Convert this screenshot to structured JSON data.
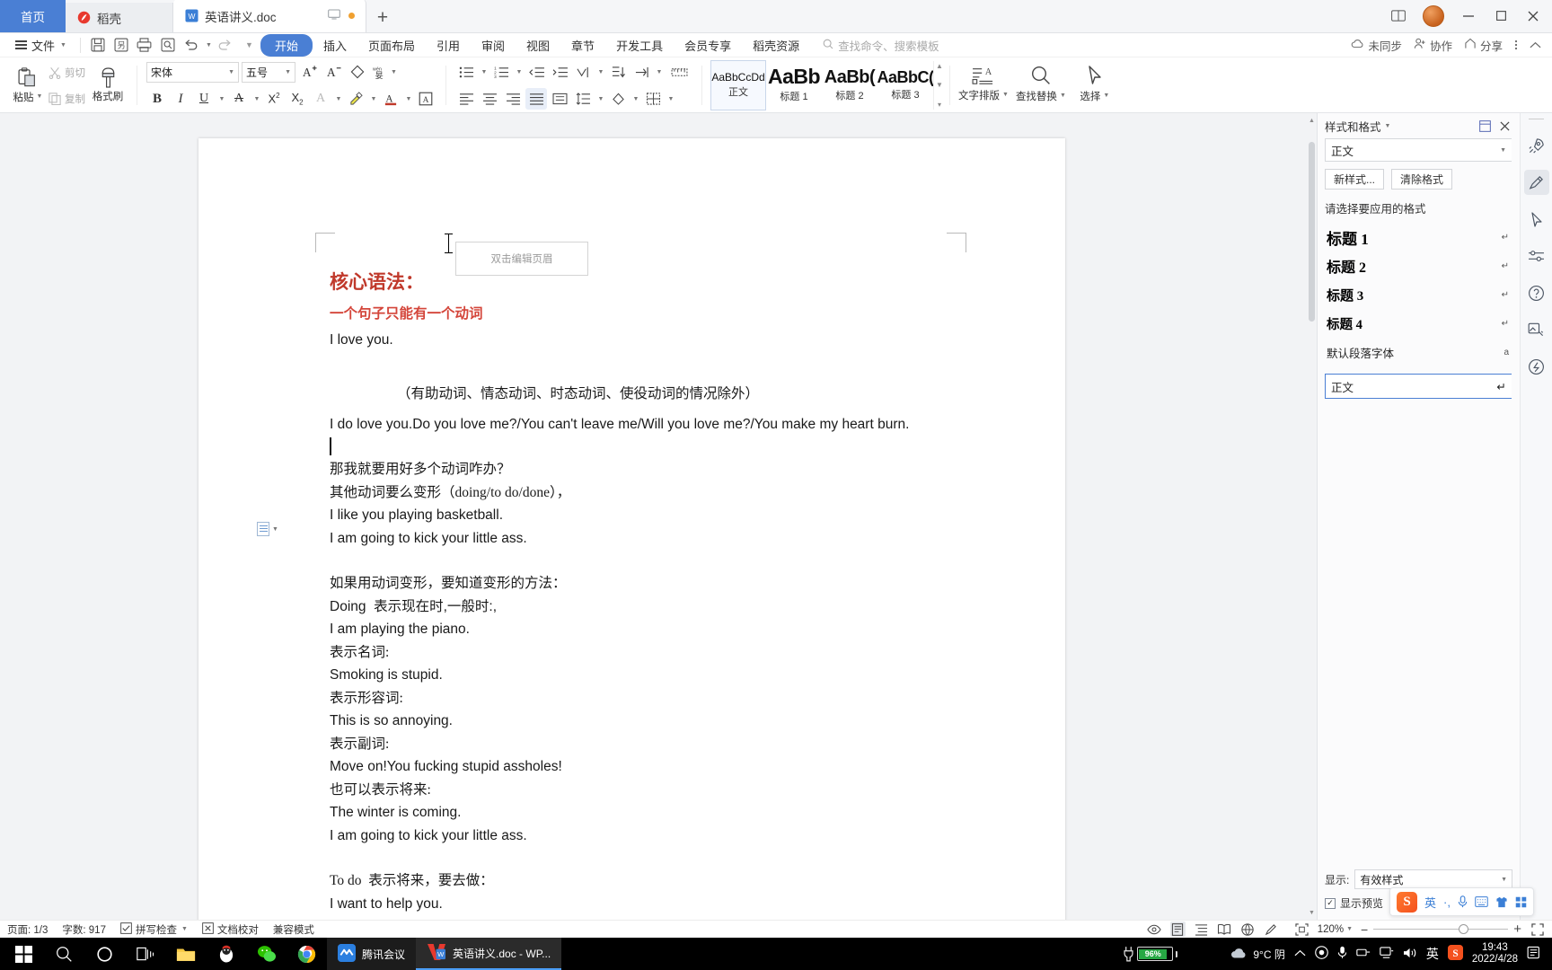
{
  "tabbar": {
    "home_label": "首页",
    "tabs": [
      {
        "label": "稻壳",
        "icon": "docer-icon"
      },
      {
        "label": "英语讲义.doc",
        "icon": "wps-doc-icon"
      }
    ],
    "new_tab_label": "+",
    "window_buttons": {
      "minimize": "—",
      "maximize": "▢",
      "close": "✕"
    }
  },
  "menubar": {
    "file_label": "文件",
    "quick_icons": [
      "save-icon",
      "save-as-icon",
      "print-icon",
      "print-preview-icon",
      "undo-icon",
      "redo-icon",
      "customize-icon"
    ],
    "items": [
      {
        "label": "开始",
        "active": true
      },
      {
        "label": "插入",
        "active": false
      },
      {
        "label": "页面布局",
        "active": false
      },
      {
        "label": "引用",
        "active": false
      },
      {
        "label": "审阅",
        "active": false
      },
      {
        "label": "视图",
        "active": false
      },
      {
        "label": "章节",
        "active": false
      },
      {
        "label": "开发工具",
        "active": false
      },
      {
        "label": "会员专享",
        "active": false
      },
      {
        "label": "稻壳资源",
        "active": false
      }
    ],
    "search_placeholder": "查找命令、搜索模板",
    "right_items": [
      {
        "label": "未同步",
        "icon": "cloud-sync-icon"
      },
      {
        "label": "协作",
        "icon": "collaborate-icon"
      },
      {
        "label": "分享",
        "icon": "share-icon"
      }
    ]
  },
  "ribbon": {
    "paste_label": "粘贴",
    "cut_label": "剪切",
    "copy_label": "复制",
    "format_painter_label": "格式刷",
    "font_name": "宋体",
    "font_size": "五号",
    "style_gallery": [
      {
        "preview": "AaBbCcDd",
        "name": "正文",
        "selected": true
      },
      {
        "preview": "AaBb",
        "name": "标题 1",
        "selected": false
      },
      {
        "preview": "AaBb(",
        "name": "标题 2",
        "selected": false
      },
      {
        "preview": "AaBbC(",
        "name": "标题 3",
        "selected": false
      }
    ],
    "text_layout_label": "文字排版",
    "find_replace_label": "查找替换",
    "select_label": "选择"
  },
  "document": {
    "header_hint": "双击编辑页眉",
    "paragraphs": [
      {
        "text": "核心语法：",
        "style": "title-red"
      },
      {
        "text": "一个句子只能有一个动词",
        "style": "sub-red"
      },
      {
        "text": "I love you.",
        "style": "body"
      },
      {
        "text": "",
        "style": "blank"
      },
      {
        "text": "（有助动词、情态动词、时态动词、使役动词的情况除外）",
        "style": "indent"
      },
      {
        "text": "I do love you.Do you love me?/You can't leave me/Will you love me?/You make my heart burn.",
        "style": "body"
      },
      {
        "text": "",
        "style": "cursorline"
      },
      {
        "text": "那我就要用好多个动词咋办？",
        "style": "cn"
      },
      {
        "text": "其他动词要么变形（doing/to do/done），",
        "style": "cn"
      },
      {
        "text": "I like you playing basketball.",
        "style": "body"
      },
      {
        "text": "I am going to kick your little ass.",
        "style": "body"
      },
      {
        "text": "",
        "style": "blank"
      },
      {
        "text": "如果用动词变形，要知道变形的方法：",
        "style": "cn"
      },
      {
        "text": "Doing  表示现在时,一般时:,",
        "style": "body"
      },
      {
        "text": "I am playing the piano.",
        "style": "body"
      },
      {
        "text": "表示名词:",
        "style": "cn"
      },
      {
        "text": "Smoking is stupid.",
        "style": "body"
      },
      {
        "text": "表示形容词:",
        "style": "cn"
      },
      {
        "text": "This is so annoying.",
        "style": "body"
      },
      {
        "text": "表示副词:",
        "style": "cn"
      },
      {
        "text": "Move on!You fucking stupid assholes!",
        "style": "body"
      },
      {
        "text": "也可以表示将来:",
        "style": "cn"
      },
      {
        "text": "The winter is coming.",
        "style": "body"
      },
      {
        "text": "I am going to kick your little ass.",
        "style": "body"
      },
      {
        "text": "",
        "style": "blank"
      },
      {
        "text": "To do  表示将来，要去做：",
        "style": "cn"
      },
      {
        "text": "I want to help you.",
        "style": "body"
      }
    ]
  },
  "styles_panel": {
    "title": "样式和格式",
    "current_style": "正文",
    "new_style_button": "新样式...",
    "clear_format_button": "清除格式",
    "pick_label": "请选择要应用的格式",
    "list": [
      {
        "name": "标题 1",
        "mark": "↵",
        "cls": "h1"
      },
      {
        "name": "标题 2",
        "mark": "↵",
        "cls": "h2"
      },
      {
        "name": "标题 3",
        "mark": "↵",
        "cls": "h3"
      },
      {
        "name": "标题 4",
        "mark": "↵",
        "cls": "h4"
      },
      {
        "name": "默认段落字体",
        "mark": "a",
        "cls": "def"
      }
    ],
    "selected_item": "正文",
    "selected_mark": "↵",
    "show_label": "显示:",
    "show_value": "有效样式",
    "preview_checkbox_label": "显示预览"
  },
  "rail": {
    "icons": [
      "rocket-icon",
      "pen-edit-icon",
      "cursor-select-icon",
      "settings-sliders-icon",
      "help-circle-icon",
      "image-tools-icon",
      "shield-idea-icon"
    ]
  },
  "statusbar": {
    "page_label": "页面: 1/3",
    "word_count_label": "字数: 917",
    "spellcheck_label": "拼写检查",
    "proofread_label": "文档校对",
    "compat_label": "兼容模式",
    "view_icons": [
      "eye-icon",
      "page-view-icon",
      "outline-view-icon",
      "reading-view-icon",
      "web-view-icon",
      "edit-pen-icon",
      "fit-page-icon"
    ],
    "zoom_level": "120%",
    "zoom_minus": "−",
    "zoom_plus": "+",
    "fullscreen_icon": "expand-icon"
  },
  "ime": {
    "logo": "S",
    "mode_label": "英",
    "icons": [
      "punctuation-icon",
      "voice-icon",
      "keyboard-icon",
      "skin-icon",
      "toolbox-icon"
    ]
  },
  "taskbar": {
    "start_icon": "windows-start-icon",
    "system_icons": [
      "search-icon",
      "cortana-icon",
      "task-view-icon"
    ],
    "pinned": [
      "file-explorer-icon",
      "qq-icon",
      "wechat-icon",
      "chrome-icon"
    ],
    "apps": [
      {
        "label": "腾讯会议",
        "icon": "tencent-meeting-icon",
        "state": "open"
      },
      {
        "label": "英语讲义.doc - WP...",
        "icon": "wps-icon",
        "state": "active"
      }
    ],
    "battery_percent": "96%",
    "weather": "9°C 阴",
    "tray_icons": [
      "chevron-up-icon",
      "onedrive-icon",
      "mic-icon",
      "network-icon",
      "display-icon",
      "volume-icon"
    ],
    "ime_label": "英",
    "sogou_label": "S",
    "time": "19:43",
    "date": "2022/4/28",
    "notification_icon": "notification-icon"
  },
  "colors": {
    "accent": "#4a7fd4",
    "title_red": "#c0392b",
    "sub_red": "#d4453a",
    "battery_green": "#27a844"
  }
}
